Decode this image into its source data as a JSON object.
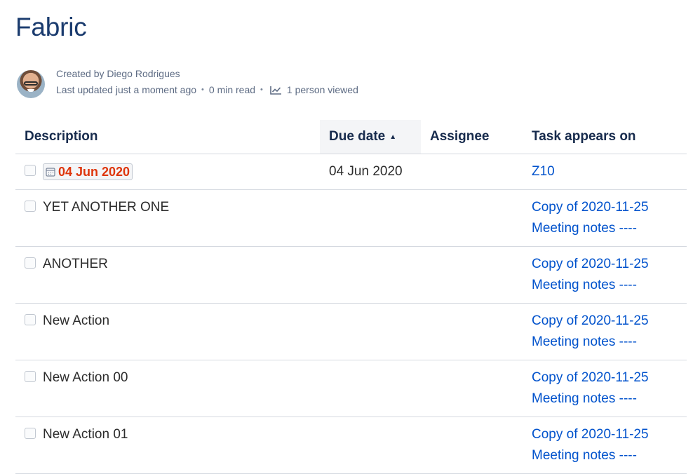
{
  "page": {
    "title": "Fabric"
  },
  "byline": {
    "created_by": "Created by Diego Rodrigues",
    "last_updated": "Last updated just a moment ago",
    "read_time": "0 min read",
    "viewed": "1 person viewed",
    "separator": "•"
  },
  "table": {
    "headers": {
      "description": "Description",
      "due_date": "Due date",
      "assignee": "Assignee",
      "appears_on": "Task appears on"
    },
    "sort": {
      "column": "due_date",
      "direction": "ascending"
    },
    "rows": [
      {
        "description": "",
        "description_date": "04 Jun 2020",
        "due_date": "04 Jun 2020",
        "assignee": "",
        "appears_on": [
          "Z10"
        ]
      },
      {
        "description": "YET ANOTHER ONE",
        "due_date": "",
        "assignee": "",
        "appears_on": [
          "Copy of 2020-11-25",
          "Meeting notes ----"
        ]
      },
      {
        "description": "ANOTHER",
        "due_date": "",
        "assignee": "",
        "appears_on": [
          "Copy of 2020-11-25",
          "Meeting notes ----"
        ]
      },
      {
        "description": "New Action",
        "due_date": "",
        "assignee": "",
        "appears_on": [
          "Copy of 2020-11-25",
          "Meeting notes ----"
        ]
      },
      {
        "description": "New Action 00",
        "due_date": "",
        "assignee": "",
        "appears_on": [
          "Copy of 2020-11-25",
          "Meeting notes ----"
        ]
      },
      {
        "description": "New Action 01",
        "due_date": "",
        "assignee": "",
        "appears_on": [
          "Copy of 2020-11-25",
          "Meeting notes ----"
        ]
      }
    ]
  },
  "colors": {
    "title": "#1a3b6e",
    "link": "#0052cc",
    "overdue_date": "#de350b",
    "meta_text": "#5e6c84"
  },
  "icons": {
    "avatar": "avatar",
    "analytics": "line-chart-icon",
    "calendar": "calendar-icon",
    "sort": "sort-ascending-icon"
  }
}
